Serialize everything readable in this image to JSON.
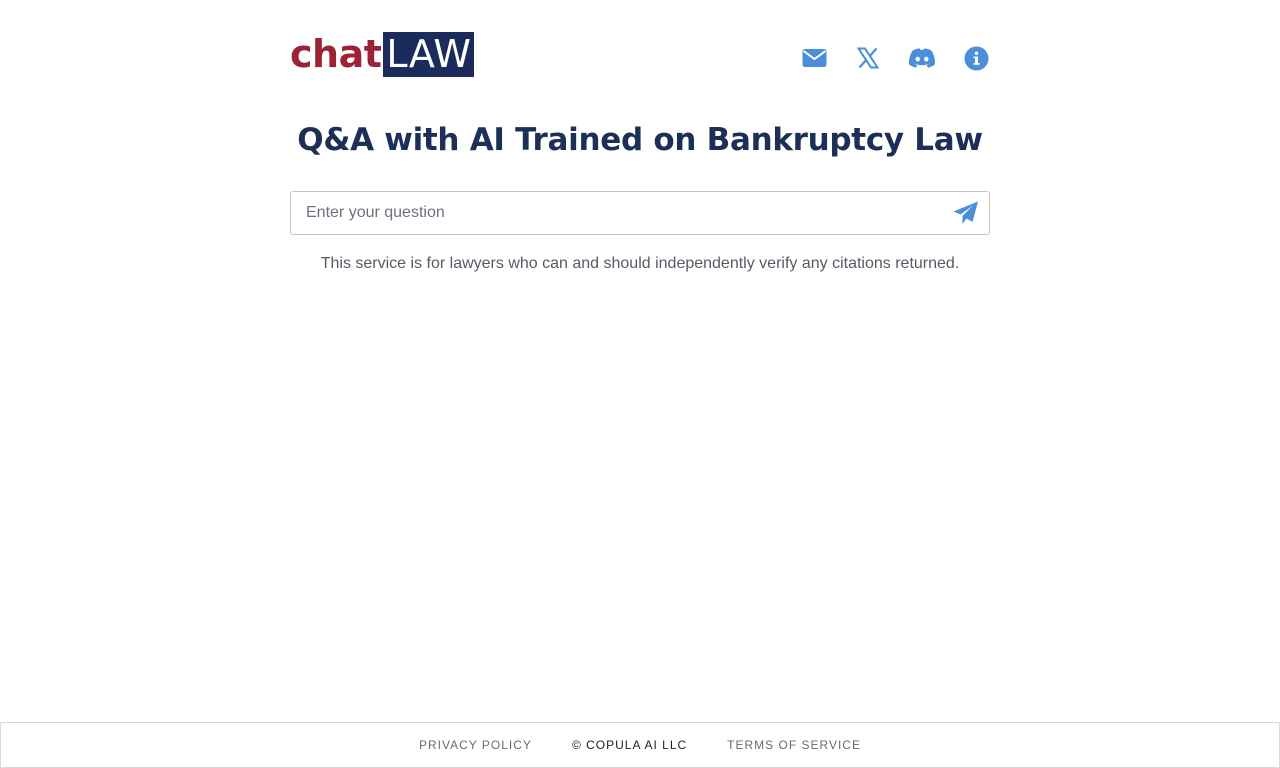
{
  "brand": {
    "logo_chat": "chat",
    "logo_law": "LAW",
    "chat_color": "#9b2335",
    "law_bg": "#1a2b5c",
    "law_color": "#ffffff"
  },
  "header": {
    "icons": [
      {
        "name": "envelope-icon"
      },
      {
        "name": "x-twitter-icon"
      },
      {
        "name": "discord-icon"
      },
      {
        "name": "info-icon"
      }
    ],
    "icon_color": "#4a8fd9"
  },
  "main": {
    "title": "Q&A with AI Trained on Bankruptcy Law",
    "title_color": "#1c2f57",
    "search_placeholder": "Enter your question",
    "search_value": "",
    "disclaimer": "This service is for lawyers who can and should independently verify any citations returned."
  },
  "footer": {
    "privacy": "PRIVACY POLICY",
    "copyright": "© COPULA AI LLC",
    "terms": "TERMS OF SERVICE"
  }
}
